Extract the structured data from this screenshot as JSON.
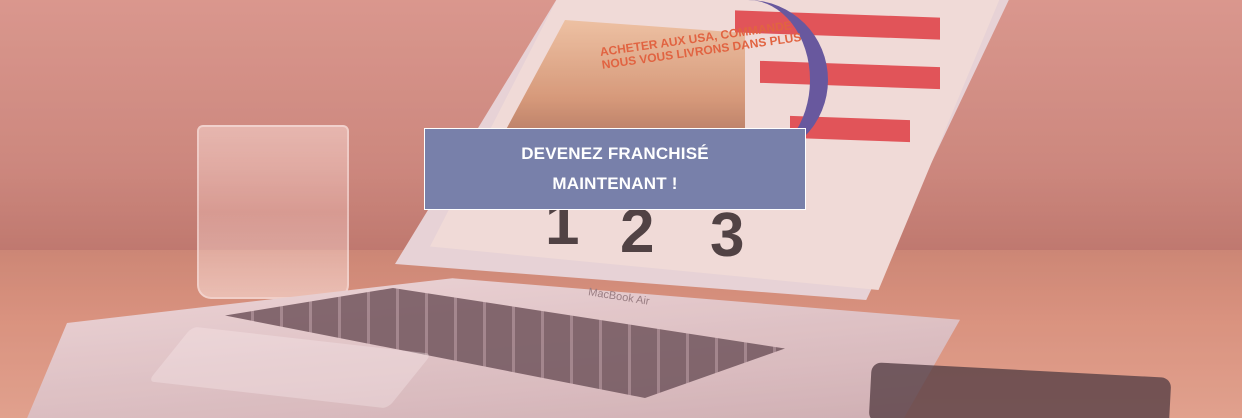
{
  "hero": {
    "cta_line1": "DEVENEZ FRANCHISÉ",
    "cta_line2": "MAINTENANT !"
  },
  "screen_content": {
    "headline_line1": "ACHETER AUX USA, COMMANDE",
    "headline_line2": "NOUS VOUS LIVRONS DANS PLUS",
    "step1": "1",
    "step2": "2",
    "step3": "3"
  },
  "laptop": {
    "brand": "MacBook Air"
  },
  "colors": {
    "cta_bg": "#7880aa",
    "flag_red": "#e2494c",
    "headline_orange": "#e25b2f"
  }
}
